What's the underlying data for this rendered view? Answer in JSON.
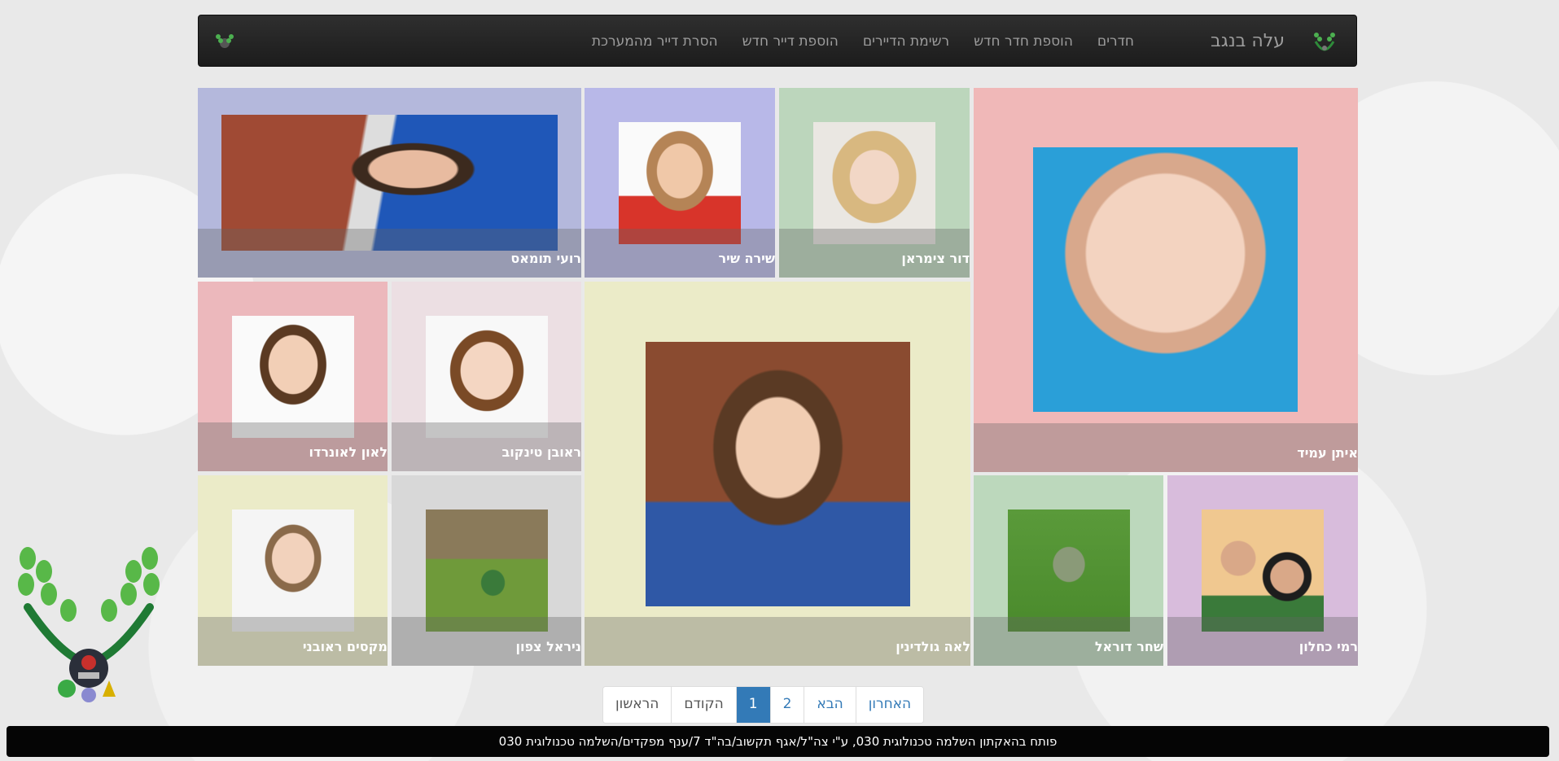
{
  "app": {
    "title": "עלה בנגב"
  },
  "nav": {
    "items": [
      "חדרים",
      "הוספת חדר חדש",
      "רשימת הדיירים",
      "הוספת דייר חדש",
      "הסרת דייר מהמערכת"
    ]
  },
  "residents": [
    {
      "name": "איתן עמיד",
      "bg": "#f0b8b8",
      "photo": "boy-closeup"
    },
    {
      "name": "דור צימראן",
      "bg": "#bcd6bc",
      "photo": "girl-portrait"
    },
    {
      "name": "שירה שיר",
      "bg": "#b8b8e8",
      "photo": "boy-ears-covered"
    },
    {
      "name": "רועי תומאס",
      "bg": "#b4b8dc",
      "photo": "boy-bubbles"
    },
    {
      "name": "לאה גולדינין",
      "bg": "#ebebc8",
      "photo": "girl-smiling"
    },
    {
      "name": "ראובן טינקוב",
      "bg": "#ecdfe3",
      "photo": "toddler-thinking"
    },
    {
      "name": "לאון לאונרדו",
      "bg": "#ecb8bc",
      "photo": "toddler-portrait"
    },
    {
      "name": "רמי כחלון",
      "bg": "#d8bcdc",
      "photo": "father-son"
    },
    {
      "name": "שחר דוראל",
      "bg": "#bcd8bc",
      "photo": "boy-grass"
    },
    {
      "name": "ניראל צפון",
      "bg": "#d8d8d8",
      "photo": "boy-sitting-grass"
    },
    {
      "name": "מקסים ראובני",
      "bg": "#ebebc8",
      "photo": "toddler-laughing"
    }
  ],
  "pagination": {
    "items": [
      "הראשון",
      "הקודם",
      "1",
      "2",
      "הבא",
      "האחרון"
    ],
    "active": "1"
  },
  "footer": {
    "text": "פותח בהאקתון השלמה טכנולוגית 030, ע\"י צה\"ל/אגף תקשוב/בה\"ד 7/ענף מפקדים/השלמה טכנולוגית 030"
  }
}
